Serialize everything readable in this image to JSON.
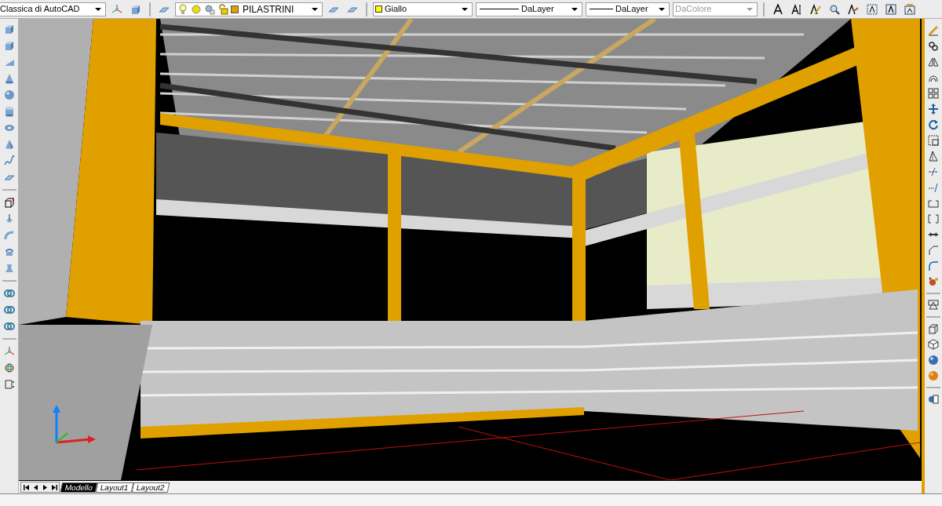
{
  "toolbar": {
    "workspace": "Classica di AutoCAD",
    "layer": "PILASTRINI",
    "color": {
      "label": "Giallo",
      "color": "#ffff00"
    },
    "linetype": "DaLayer",
    "lineweight": "DaLayer",
    "plot_style": {
      "label": "DaColore",
      "disabled": true
    }
  },
  "layout_tabs": [
    {
      "label": "Modello",
      "selected": true
    },
    {
      "label": "Layout1",
      "selected": false
    },
    {
      "label": "Layout2",
      "selected": false
    }
  ]
}
